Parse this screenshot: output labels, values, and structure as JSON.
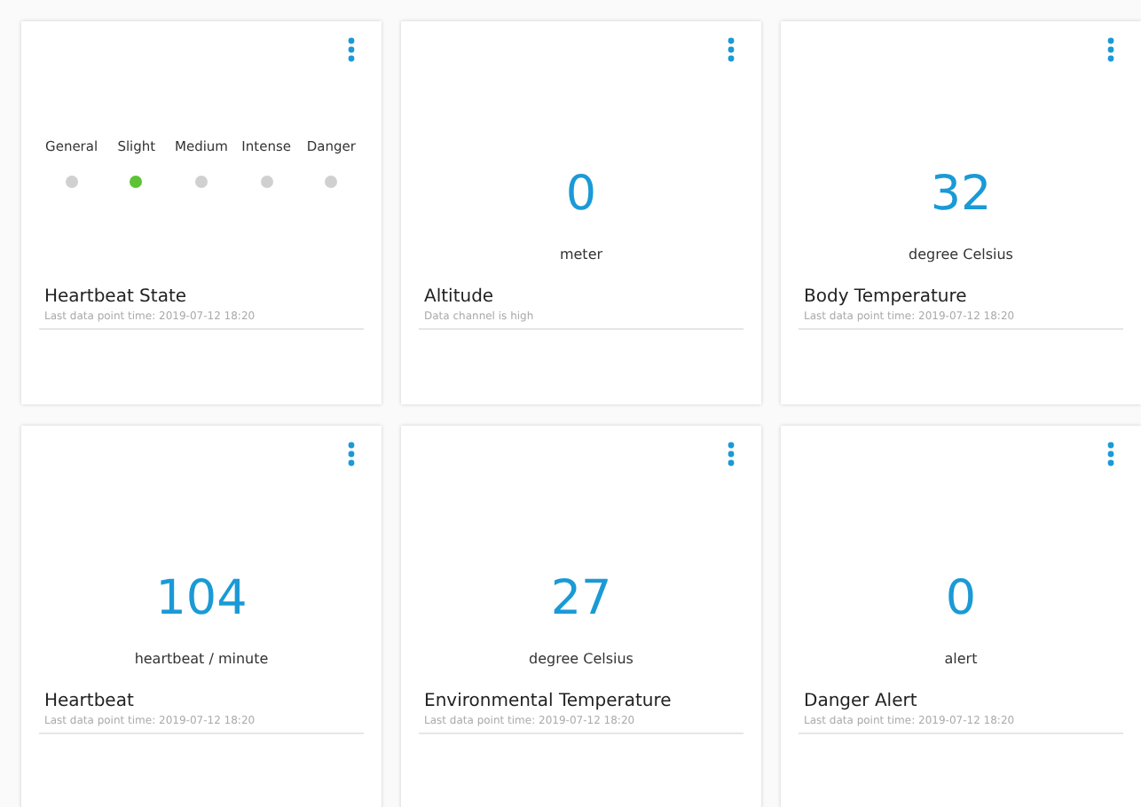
{
  "cards": [
    {
      "kind": "levels",
      "levels": [
        {
          "label": "General",
          "selected": false
        },
        {
          "label": "Slight",
          "selected": true
        },
        {
          "label": "Medium",
          "selected": false
        },
        {
          "label": "Intense",
          "selected": false
        },
        {
          "label": "Danger",
          "selected": false
        }
      ],
      "title": "Heartbeat State",
      "subtitle": "Last data point time: 2019-07-12 18:20"
    },
    {
      "kind": "value",
      "value": "0",
      "unit": "meter",
      "title": "Altitude",
      "subtitle": "Data channel is high"
    },
    {
      "kind": "value",
      "value": "32",
      "unit": "degree Celsius",
      "title": "Body Temperature",
      "subtitle": "Last data point time: 2019-07-12 18:20"
    },
    {
      "kind": "value",
      "value": "104",
      "unit": "heartbeat / minute",
      "title": "Heartbeat",
      "subtitle": "Last data point time: 2019-07-12 18:20"
    },
    {
      "kind": "value",
      "value": "27",
      "unit": "degree Celsius",
      "title": "Environmental Temperature",
      "subtitle": "Last data point time: 2019-07-12 18:20"
    },
    {
      "kind": "value",
      "value": "0",
      "unit": "alert",
      "title": "Danger Alert",
      "subtitle": "Last data point time: 2019-07-12 18:20"
    }
  ]
}
